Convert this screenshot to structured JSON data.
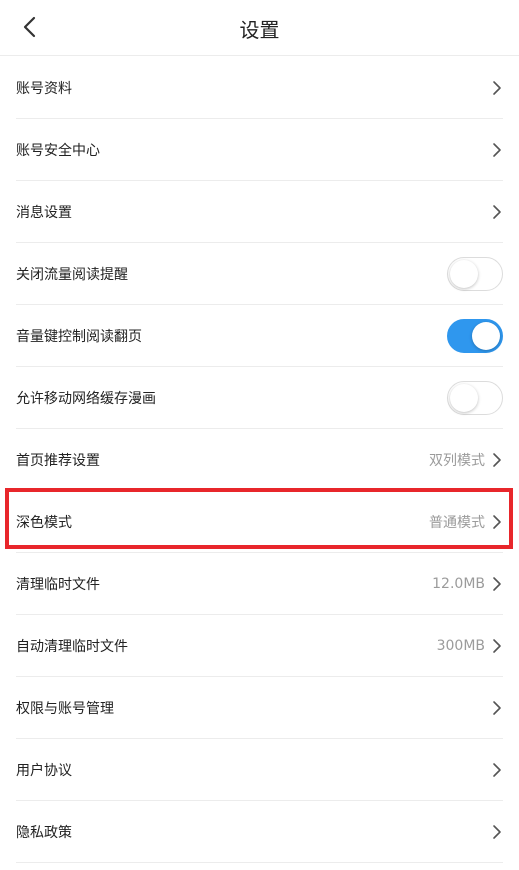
{
  "header": {
    "title": "设置",
    "back_icon": "chevron-left-icon"
  },
  "colors": {
    "accent": "#2f97ee",
    "highlight": "#e8262b",
    "value_gray": "#9b9b9b"
  },
  "settings": [
    {
      "label": "账号资料",
      "kind": "link"
    },
    {
      "label": "账号安全中心",
      "kind": "link"
    },
    {
      "label": "消息设置",
      "kind": "link"
    },
    {
      "label": "关闭流量阅读提醒",
      "kind": "toggle",
      "on": false
    },
    {
      "label": "音量键控制阅读翻页",
      "kind": "toggle",
      "on": true
    },
    {
      "label": "允许移动网络缓存漫画",
      "kind": "toggle",
      "on": false
    },
    {
      "label": "首页推荐设置",
      "kind": "link",
      "value": "双列模式"
    },
    {
      "label": "深色模式",
      "kind": "link",
      "value": "普通模式"
    },
    {
      "label": "清理临时文件",
      "kind": "link",
      "value": "12.0MB"
    },
    {
      "label": "自动清理临时文件",
      "kind": "link",
      "value": "300MB"
    },
    {
      "label": "权限与账号管理",
      "kind": "link"
    },
    {
      "label": "用户协议",
      "kind": "link"
    },
    {
      "label": "隐私政策",
      "kind": "link"
    }
  ]
}
